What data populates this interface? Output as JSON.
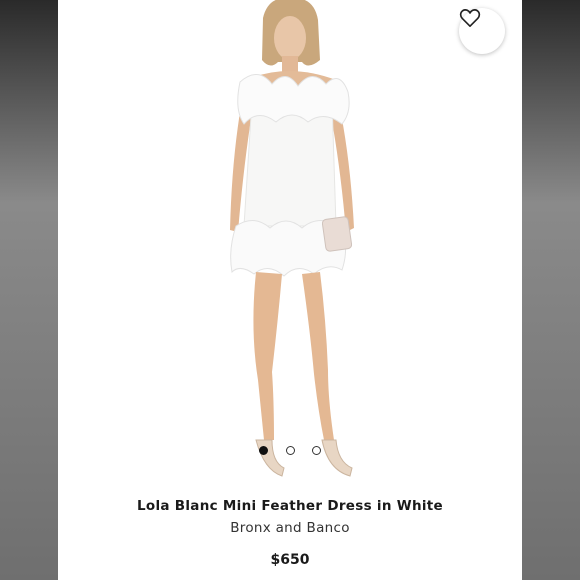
{
  "product": {
    "name": "Lola Blanc Mini Feather Dress in White",
    "brand": "Bronx and Banco",
    "price": "$650"
  },
  "gallery": {
    "image_count": 3,
    "active_index": 0
  },
  "icons": {
    "favorite": "heart-outline-icon"
  },
  "colors": {
    "card_bg": "#ffffff",
    "backdrop": "#777777",
    "active_dot": "#111111"
  }
}
